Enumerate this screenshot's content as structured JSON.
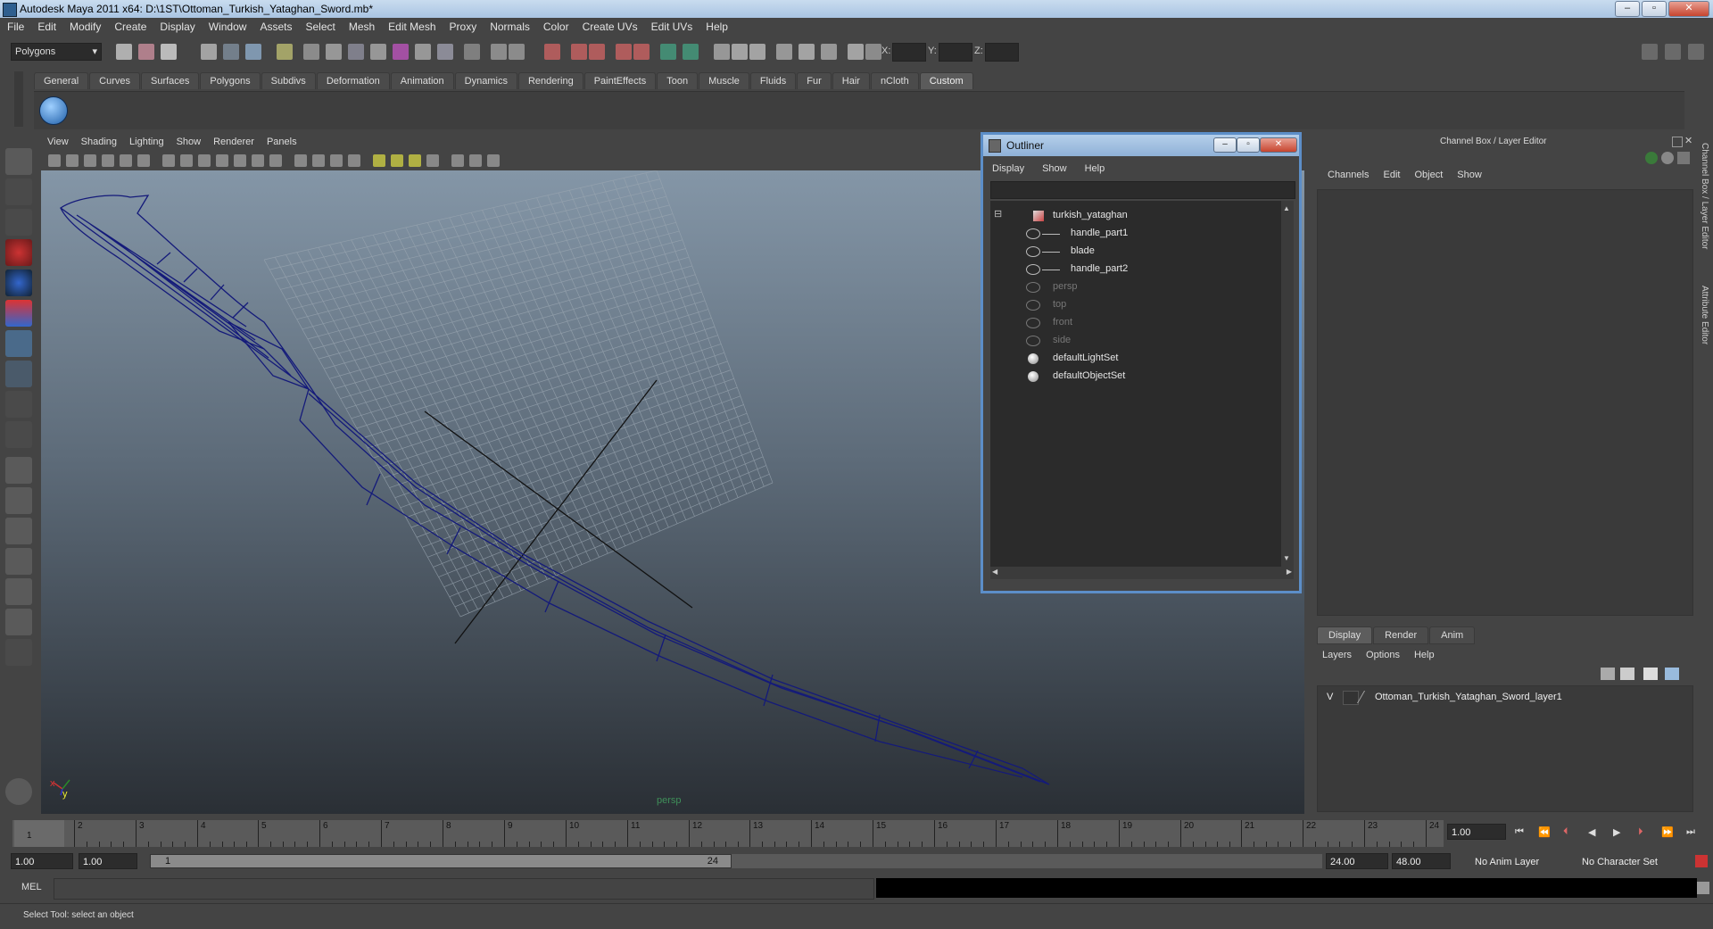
{
  "window": {
    "title": "Autodesk Maya 2011 x64: D:\\1ST\\Ottoman_Turkish_Yataghan_Sword.mb*"
  },
  "menubar": [
    "File",
    "Edit",
    "Modify",
    "Create",
    "Display",
    "Window",
    "Assets",
    "Select",
    "Mesh",
    "Edit Mesh",
    "Proxy",
    "Normals",
    "Color",
    "Create UVs",
    "Edit UVs",
    "Help"
  ],
  "statusline": {
    "mode": "Polygons",
    "x_label": "X:",
    "y_label": "Y:",
    "z_label": "Z:"
  },
  "shelf": {
    "tabs": [
      "General",
      "Curves",
      "Surfaces",
      "Polygons",
      "Subdivs",
      "Deformation",
      "Animation",
      "Dynamics",
      "Rendering",
      "PaintEffects",
      "Toon",
      "Muscle",
      "Fluids",
      "Fur",
      "Hair",
      "nCloth",
      "Custom"
    ],
    "active_tab": "Custom"
  },
  "viewport": {
    "menu": [
      "View",
      "Shading",
      "Lighting",
      "Show",
      "Renderer",
      "Panels"
    ],
    "camera_label": "persp",
    "axis_x": "x",
    "axis_y": "y"
  },
  "outliner": {
    "title": "Outliner",
    "menu": [
      "Display",
      "Show",
      "Help"
    ],
    "items": [
      {
        "label": "turkish_yataghan",
        "dim": false,
        "type": "group"
      },
      {
        "label": "handle_part1",
        "dim": false,
        "type": "mesh"
      },
      {
        "label": "blade",
        "dim": false,
        "type": "mesh"
      },
      {
        "label": "handle_part2",
        "dim": false,
        "type": "mesh"
      },
      {
        "label": "persp",
        "dim": true,
        "type": "camera"
      },
      {
        "label": "top",
        "dim": true,
        "type": "camera"
      },
      {
        "label": "front",
        "dim": true,
        "type": "camera"
      },
      {
        "label": "side",
        "dim": true,
        "type": "camera"
      },
      {
        "label": "defaultLightSet",
        "dim": false,
        "type": "set"
      },
      {
        "label": "defaultObjectSet",
        "dim": false,
        "type": "set"
      }
    ]
  },
  "channelbox": {
    "title": "Channel Box / Layer Editor",
    "menu": [
      "Channels",
      "Edit",
      "Object",
      "Show"
    ],
    "layer_tabs": [
      "Display",
      "Render",
      "Anim"
    ],
    "layer_menu": [
      "Layers",
      "Options",
      "Help"
    ],
    "layer": {
      "visibility": "V",
      "name": "Ottoman_Turkish_Yataghan_Sword_layer1"
    },
    "side_tabs": [
      "Channel Box / Layer Editor",
      "Attribute Editor"
    ]
  },
  "timeline": {
    "ticks": [
      "1",
      "2",
      "3",
      "4",
      "5",
      "6",
      "7",
      "8",
      "9",
      "10",
      "11",
      "12",
      "13",
      "14",
      "15",
      "16",
      "17",
      "18",
      "19",
      "20",
      "21",
      "22",
      "23",
      "24"
    ],
    "current_frame": "1.00",
    "playhead": "1"
  },
  "range": {
    "start": "1.00",
    "start2": "1.00",
    "slider_start": "1",
    "slider_end": "24",
    "end": "24.00",
    "end2": "48.00",
    "anim_layer": "No Anim Layer",
    "char_set": "No Character Set"
  },
  "mel": {
    "label": "MEL"
  },
  "status": {
    "text": "Select Tool: select an object"
  }
}
